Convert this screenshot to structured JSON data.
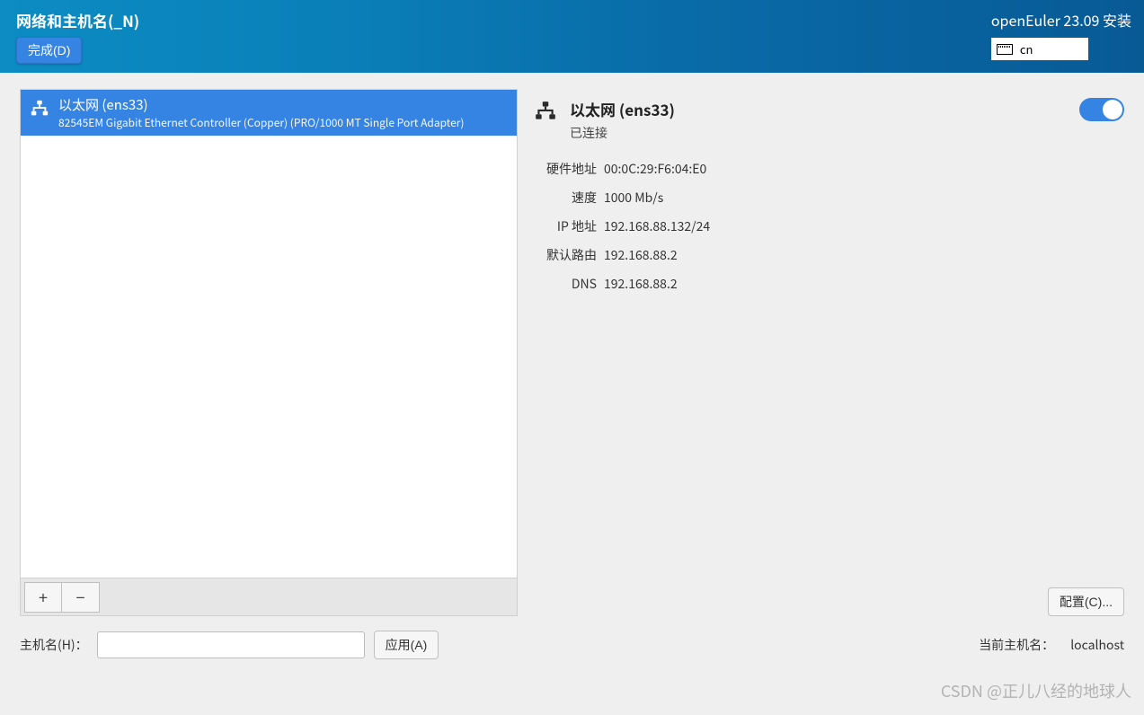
{
  "header": {
    "title": "网络和主机名(_N)",
    "done_button": "完成(D)",
    "distro": "openEuler 23.09 安装",
    "keyboard_layout": "cn"
  },
  "device_list": {
    "items": [
      {
        "name": "以太网 (ens33)",
        "description": "82545EM Gigabit Ethernet Controller (Copper) (PRO/1000 MT Single Port Adapter)",
        "selected": true
      }
    ],
    "add_tooltip": "+",
    "remove_tooltip": "−"
  },
  "details": {
    "connection_name": "以太网 (ens33)",
    "status": "已连接",
    "toggle_on": true,
    "rows": [
      {
        "label": "硬件地址",
        "value": "00:0C:29:F6:04:E0"
      },
      {
        "label": "速度",
        "value": "1000 Mb/s"
      },
      {
        "label": "IP 地址",
        "value": "192.168.88.132/24"
      },
      {
        "label": "默认路由",
        "value": "192.168.88.2"
      },
      {
        "label": "DNS",
        "value": "192.168.88.2"
      }
    ],
    "configure_button": "配置(C)..."
  },
  "hostname": {
    "label": "主机名(H)：",
    "value": "",
    "apply_button": "应用(A)",
    "current_label": "当前主机名：",
    "current_value": "localhost"
  },
  "watermark": "CSDN @正儿八经的地球人"
}
